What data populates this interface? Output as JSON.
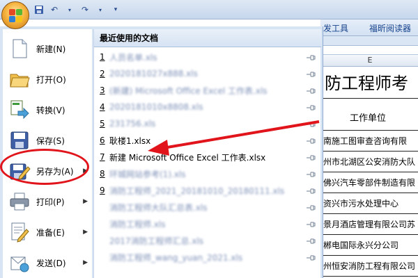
{
  "ribbon": {
    "tabs": [
      "发工具",
      "福昕阅读器"
    ]
  },
  "sheet": {
    "column_letter": "E",
    "title": "防工程师考",
    "header": "工作单位",
    "rows": [
      "南施工图审查咨询有限",
      "州市北湖区公安消防大队",
      "佛兴汽车零部件制造有限",
      "资兴市污水处理中心",
      "景月酒店管理有限公司苏",
      "郴电国际永兴分公司",
      "州恒安消防工程有限公司",
      ""
    ]
  },
  "menu": {
    "items": [
      {
        "label": "新建(N)",
        "icon": "new-document-icon",
        "arrow": false
      },
      {
        "label": "打开(O)",
        "icon": "open-folder-icon",
        "arrow": false
      },
      {
        "label": "转换(V)",
        "icon": "convert-icon",
        "arrow": false
      },
      {
        "label": "保存(S)",
        "icon": "save-disk-icon",
        "arrow": false
      },
      {
        "label": "另存为(A)",
        "icon": "save-as-icon",
        "arrow": true
      },
      {
        "label": "打印(P)",
        "icon": "printer-icon",
        "arrow": true
      },
      {
        "label": "准备(E)",
        "icon": "prepare-icon",
        "arrow": true
      },
      {
        "label": "发送(D)",
        "icon": "send-icon",
        "arrow": true
      }
    ],
    "recent_title": "最近使用的文档",
    "recent": [
      {
        "num": "1",
        "name": "人员名单.xls",
        "blurred": true
      },
      {
        "num": "2",
        "name": "2020181027x888.xls",
        "blurred": true
      },
      {
        "num": "3",
        "name": "(新建) Microsoft Office Excel 工作表.xls",
        "blurred": true
      },
      {
        "num": "4",
        "name": "2020181010x8808.xls",
        "blurred": true
      },
      {
        "num": "5",
        "name": "231756.xls",
        "blurred": true
      },
      {
        "num": "6",
        "name": "耿楼1.xlsx",
        "blurred": false
      },
      {
        "num": "7",
        "name": "新建 Microsoft Office Excel 工作表.xlsx",
        "blurred": false
      },
      {
        "num": "8",
        "name": "环城网站参考(1).xls",
        "blurred": true
      },
      {
        "num": "9",
        "name": "消防工程师_2021_20181010_20180111.xls",
        "blurred": true
      },
      {
        "num": "",
        "name": "消防工程师大队汇总表.xls",
        "blurred": true
      },
      {
        "num": "",
        "name": "消防工程师.xls",
        "blurred": true
      },
      {
        "num": "",
        "name": "2017消防工程师汇总.xls",
        "blurred": true
      },
      {
        "num": "",
        "name": "消防工程师_wang_yuan_2021.xls",
        "blurred": true
      }
    ]
  },
  "colors": {
    "annotation_red": "#e0141a",
    "ribbon_text": "#15428b"
  }
}
